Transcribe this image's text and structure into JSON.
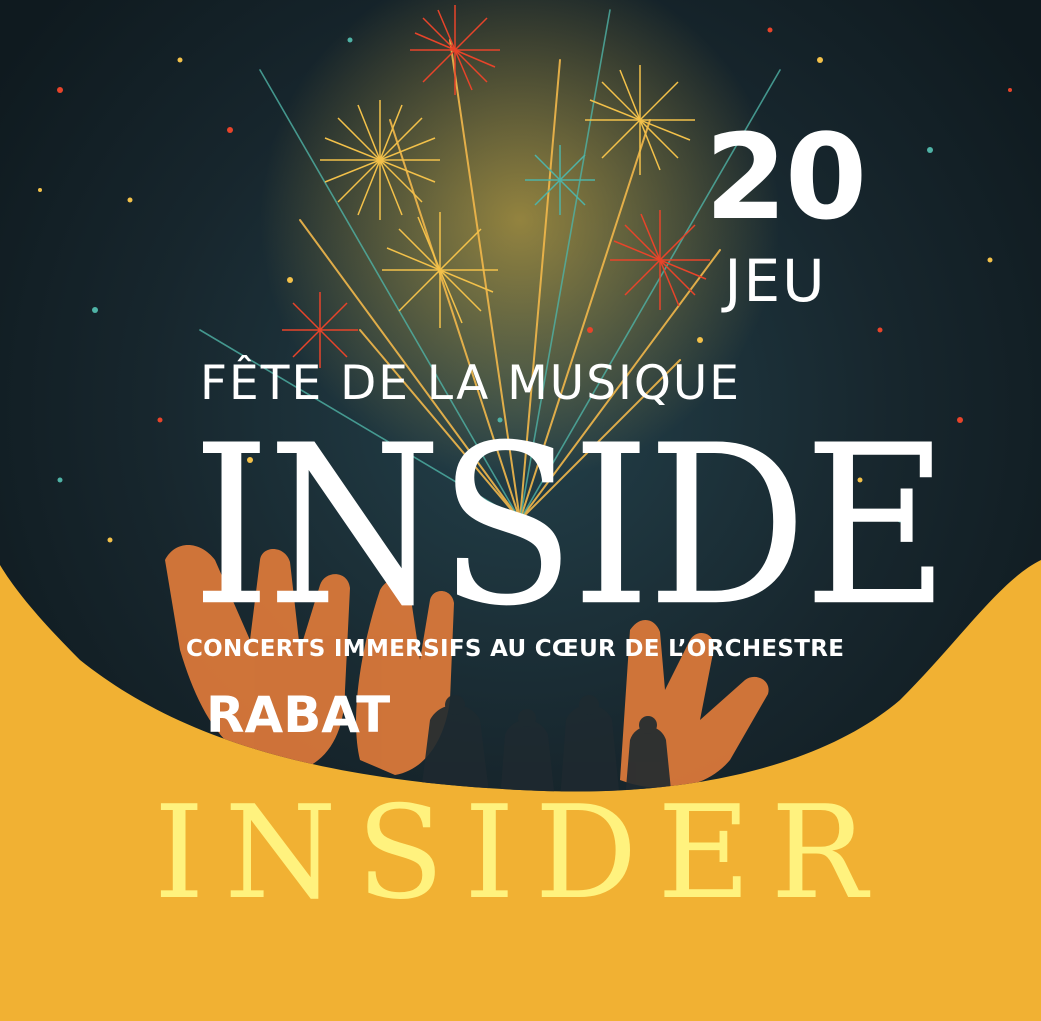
{
  "event": {
    "date_number": "20",
    "date_day": "JEU",
    "name": "FÊTE DE LA MUSIQUE",
    "show_title": "INSIDE",
    "tagline": "CONCERTS IMMERSIFS AU CŒUR DE L’ORCHESTRE",
    "city": "RABAT"
  },
  "brand": {
    "name": "INSIDER"
  },
  "colors": {
    "night_sky": "#16252c",
    "accent_yellow": "#f1b133",
    "brand_text": "#fff27e",
    "text": "#ffffff"
  }
}
